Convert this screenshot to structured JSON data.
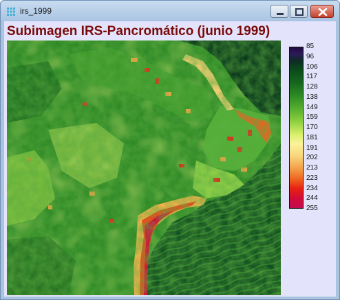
{
  "window": {
    "title": "irs_1999",
    "icon": "app-grid-icon",
    "controls": [
      "minimize-icon",
      "maximize-icon",
      "close-icon"
    ]
  },
  "figure": {
    "title": "Subimagen IRS-Pancromático (junio 1999)"
  },
  "colorbar": {
    "labels": [
      "85",
      "96",
      "106",
      "117",
      "128",
      "138",
      "149",
      "159",
      "170",
      "181",
      "191",
      "202",
      "213",
      "223",
      "234",
      "244",
      "255"
    ]
  },
  "colors": {
    "title": "#7a0a0a",
    "client_background": "#e3e3fb",
    "titlebar": "#a9c4e2",
    "close_button": "#c6402c"
  }
}
